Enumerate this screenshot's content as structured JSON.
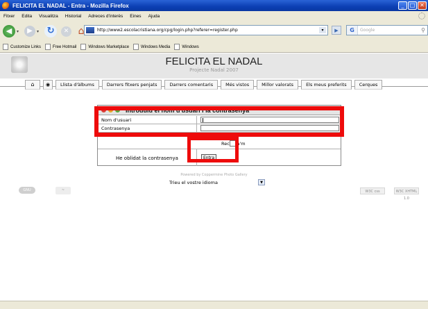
{
  "window": {
    "title": "FELICITA EL NADAL - Entra - Mozilla Firefox",
    "buttons": [
      "_",
      "□",
      "✕"
    ]
  },
  "menu": [
    "Fitxer",
    "Edita",
    "Visualitza",
    "Historial",
    "Adreces d'interès",
    "Eines",
    "Ajuda"
  ],
  "toolbar": {
    "url": "http://www2.escolacristiana.org/cpg/login.php?referer=register.php",
    "search_placeholder": "Google"
  },
  "bookmarks": [
    "Customize Links",
    "Free Hotmail",
    "Windows Marketplace",
    "Windows Media",
    "Windows"
  ],
  "site": {
    "title": "FELICITA EL NADAL",
    "subtitle": "Projecte Nadal 2007"
  },
  "nav_tabs": [
    "Llista d'àlbums",
    "Darrers fitxers penjats",
    "Darrers comentaris",
    "Més vistos",
    "Millor valorats",
    "Els meus preferits",
    "Cerques"
  ],
  "login": {
    "heading": "Introduïu el nom d'usuari i la contrasenya",
    "username_label": "Nom d'usuari",
    "password_label": "Contrasenya",
    "remember_label": "Recorda'm",
    "forgot_label": "He oblidat la contrasenya",
    "submit_label": "Entra"
  },
  "footer": {
    "powered": "Powered by Coppermine Photo Gallery",
    "language_label": "Trieu el vostre idioma",
    "w3c_css": "W3C css",
    "w3c_xhtml": "W3C XHTML 1.0"
  },
  "colors": {
    "highlight": "#ee0b0b",
    "titlebar": "#0b3fb3",
    "chrome": "#ece9d8"
  }
}
